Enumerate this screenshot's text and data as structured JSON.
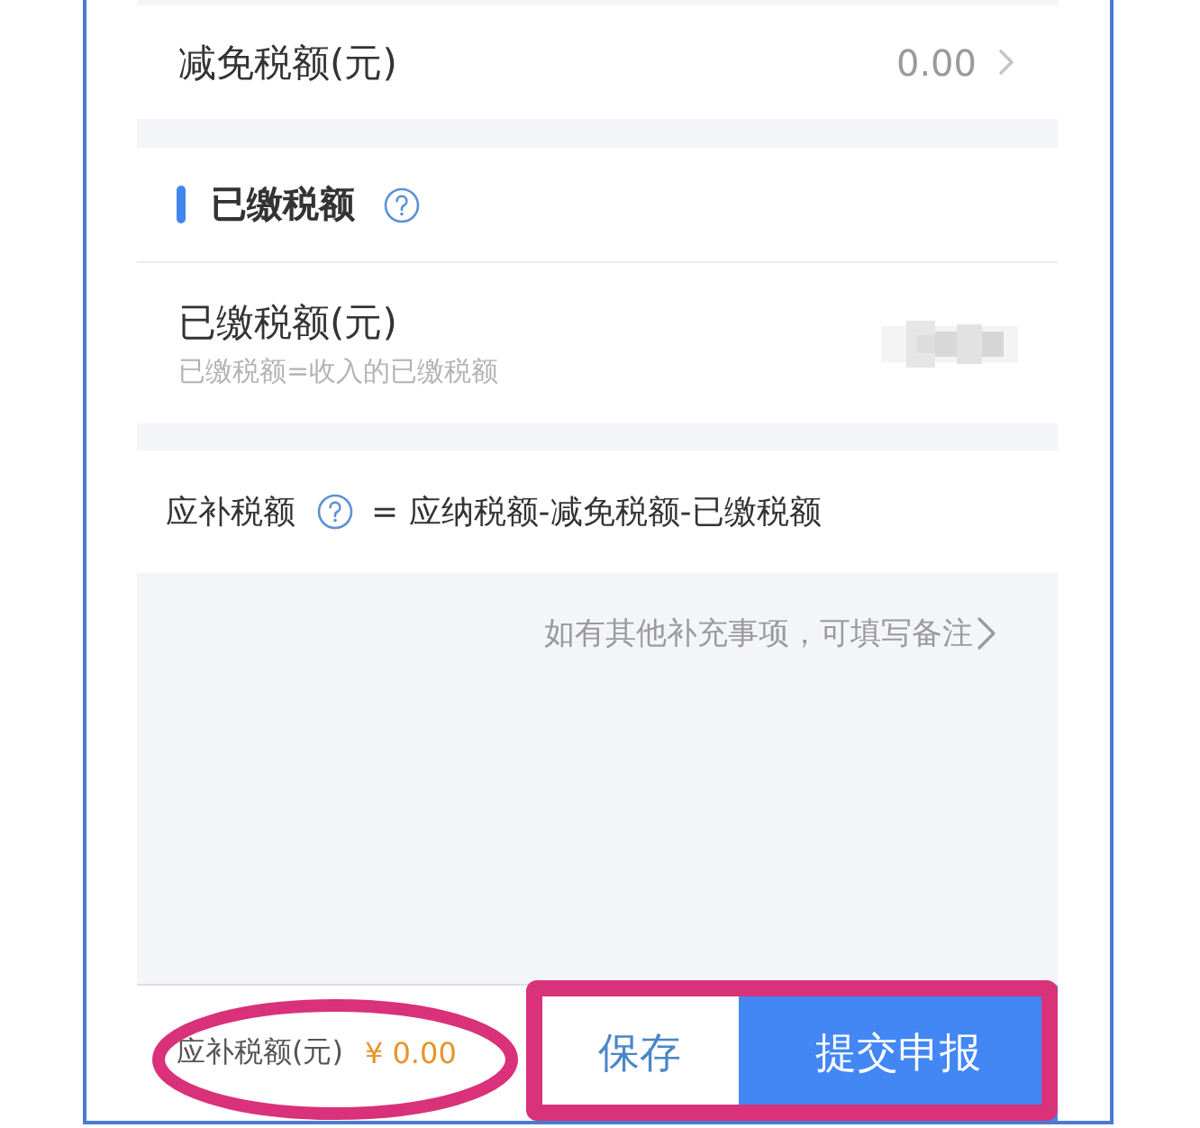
{
  "relief_row": {
    "label": "减免税额(元)",
    "value": "0.00"
  },
  "paid_section": {
    "title": "已缴税额",
    "rows": [
      {
        "label": "已缴税额(元)",
        "hint": "已缴税额=收入的已缴税额",
        "value_redacted": true
      }
    ]
  },
  "formula": {
    "label": "应补税额",
    "equation": "= 应纳税额-减免税额-已缴税额"
  },
  "remarks_link": "如有其他补充事项，可填写备注",
  "footer": {
    "total_label": "应补税额(元)",
    "total_value": "¥ 0.00",
    "total_circled": true,
    "buttons": [
      {
        "kind": "secondary",
        "label": "保存"
      },
      {
        "kind": "primary",
        "label": "提交申报"
      }
    ],
    "buttons_framed": true
  }
}
